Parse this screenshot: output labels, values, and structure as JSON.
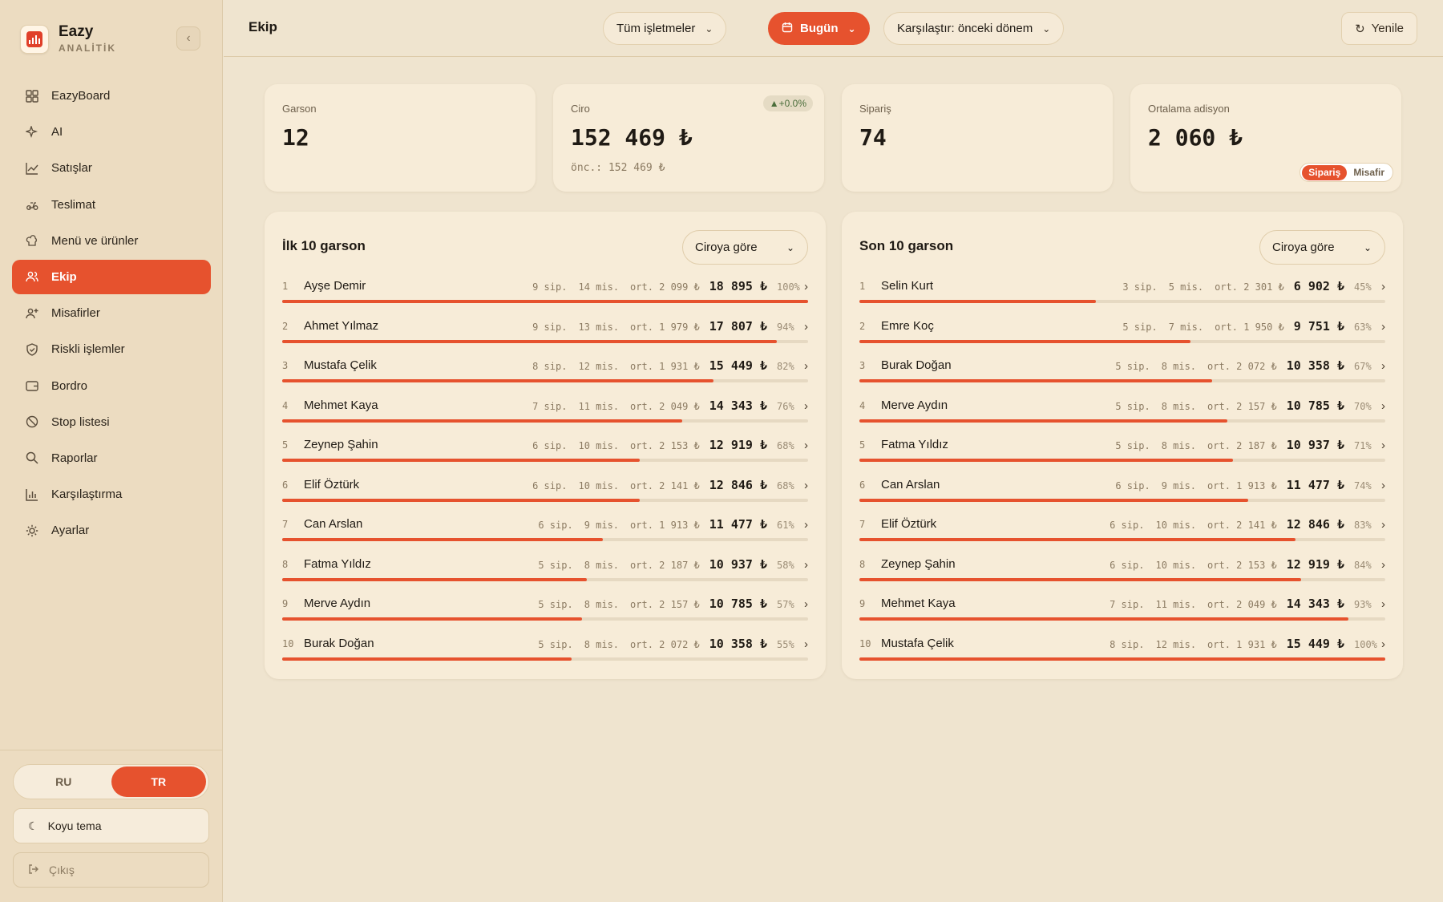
{
  "brand": {
    "name": "Eazy",
    "sub": "ANALİTİK"
  },
  "colors": {
    "accent": "#e6522e",
    "background": "#efe4cf",
    "card": "#f7ecd8"
  },
  "nav": [
    {
      "label": "EazyBoard",
      "icon": "grid-icon"
    },
    {
      "label": "AI",
      "icon": "sparkle-icon"
    },
    {
      "label": "Satışlar",
      "icon": "trend-chart-icon"
    },
    {
      "label": "Teslimat",
      "icon": "scooter-icon"
    },
    {
      "label": "Menü ve ürünler",
      "icon": "chef-icon"
    },
    {
      "label": "Ekip",
      "icon": "team-icon",
      "active": true
    },
    {
      "label": "Misafirler",
      "icon": "user-plus-icon"
    },
    {
      "label": "Riskli işlemler",
      "icon": "shield-icon"
    },
    {
      "label": "Bordro",
      "icon": "wallet-icon"
    },
    {
      "label": "Stop listesi",
      "icon": "ban-icon"
    },
    {
      "label": "Raporlar",
      "icon": "search-icon"
    },
    {
      "label": "Karşılaştırma",
      "icon": "bar-chart-icon"
    },
    {
      "label": "Ayarlar",
      "icon": "sun-gear-icon"
    }
  ],
  "lang": {
    "ru": "RU",
    "tr": "TR",
    "selected": "TR"
  },
  "theme_label": "Koyu tema",
  "logout_label": "Çıkış",
  "header": {
    "title": "Ekip",
    "business_filter": "Tüm işletmeler",
    "date_filter": "Bugün",
    "compare_filter": "Karşılaştır: önceki dönem",
    "refresh": "Yenile"
  },
  "kpis": {
    "waiters": {
      "label": "Garson",
      "value": "12"
    },
    "revenue": {
      "label": "Ciro",
      "value": "152 469 ₺",
      "prev": "önc.: 152 469 ₺",
      "badge": "▲+0.0%"
    },
    "orders": {
      "label": "Sipariş",
      "value": "74"
    },
    "avg_check": {
      "label": "Ortalama adisyon",
      "value": "2 060 ₺",
      "seg_order": "Sipariş",
      "seg_guest": "Misafir",
      "seg_selected": "Sipariş"
    }
  },
  "top_list": {
    "title": "İlk 10 garson",
    "sort": "Ciroya göre",
    "rows": [
      {
        "rank": "1",
        "name": "Ayşe Demir",
        "orders": "9 sip.",
        "guests": "14 mis.",
        "avg": "ort. 2 099 ₺",
        "amount": "18 895 ₺",
        "pct": "100%",
        "fraction": 1.0
      },
      {
        "rank": "2",
        "name": "Ahmet Yılmaz",
        "orders": "9 sip.",
        "guests": "13 mis.",
        "avg": "ort. 1 979 ₺",
        "amount": "17 807 ₺",
        "pct": "94%",
        "fraction": 0.94
      },
      {
        "rank": "3",
        "name": "Mustafa Çelik",
        "orders": "8 sip.",
        "guests": "12 mis.",
        "avg": "ort. 1 931 ₺",
        "amount": "15 449 ₺",
        "pct": "82%",
        "fraction": 0.82
      },
      {
        "rank": "4",
        "name": "Mehmet Kaya",
        "orders": "7 sip.",
        "guests": "11 mis.",
        "avg": "ort. 2 049 ₺",
        "amount": "14 343 ₺",
        "pct": "76%",
        "fraction": 0.76
      },
      {
        "rank": "5",
        "name": "Zeynep Şahin",
        "orders": "6 sip.",
        "guests": "10 mis.",
        "avg": "ort. 2 153 ₺",
        "amount": "12 919 ₺",
        "pct": "68%",
        "fraction": 0.68
      },
      {
        "rank": "6",
        "name": "Elif Öztürk",
        "orders": "6 sip.",
        "guests": "10 mis.",
        "avg": "ort. 2 141 ₺",
        "amount": "12 846 ₺",
        "pct": "68%",
        "fraction": 0.68
      },
      {
        "rank": "7",
        "name": "Can Arslan",
        "orders": "6 sip.",
        "guests": "9 mis.",
        "avg": "ort. 1 913 ₺",
        "amount": "11 477 ₺",
        "pct": "61%",
        "fraction": 0.61
      },
      {
        "rank": "8",
        "name": "Fatma Yıldız",
        "orders": "5 sip.",
        "guests": "8 mis.",
        "avg": "ort. 2 187 ₺",
        "amount": "10 937 ₺",
        "pct": "58%",
        "fraction": 0.58
      },
      {
        "rank": "9",
        "name": "Merve Aydın",
        "orders": "5 sip.",
        "guests": "8 mis.",
        "avg": "ort. 2 157 ₺",
        "amount": "10 785 ₺",
        "pct": "57%",
        "fraction": 0.57
      },
      {
        "rank": "10",
        "name": "Burak Doğan",
        "orders": "5 sip.",
        "guests": "8 mis.",
        "avg": "ort. 2 072 ₺",
        "amount": "10 358 ₺",
        "pct": "55%",
        "fraction": 0.55
      }
    ]
  },
  "bottom_list": {
    "title": "Son 10 garson",
    "sort": "Ciroya göre",
    "rows": [
      {
        "rank": "1",
        "name": "Selin Kurt",
        "orders": "3 sip.",
        "guests": "5 mis.",
        "avg": "ort. 2 301 ₺",
        "amount": "6 902 ₺",
        "pct": "45%",
        "fraction": 0.45
      },
      {
        "rank": "2",
        "name": "Emre Koç",
        "orders": "5 sip.",
        "guests": "7 mis.",
        "avg": "ort. 1 950 ₺",
        "amount": "9 751 ₺",
        "pct": "63%",
        "fraction": 0.63
      },
      {
        "rank": "3",
        "name": "Burak Doğan",
        "orders": "5 sip.",
        "guests": "8 mis.",
        "avg": "ort. 2 072 ₺",
        "amount": "10 358 ₺",
        "pct": "67%",
        "fraction": 0.67
      },
      {
        "rank": "4",
        "name": "Merve Aydın",
        "orders": "5 sip.",
        "guests": "8 mis.",
        "avg": "ort. 2 157 ₺",
        "amount": "10 785 ₺",
        "pct": "70%",
        "fraction": 0.7
      },
      {
        "rank": "5",
        "name": "Fatma Yıldız",
        "orders": "5 sip.",
        "guests": "8 mis.",
        "avg": "ort. 2 187 ₺",
        "amount": "10 937 ₺",
        "pct": "71%",
        "fraction": 0.71
      },
      {
        "rank": "6",
        "name": "Can Arslan",
        "orders": "6 sip.",
        "guests": "9 mis.",
        "avg": "ort. 1 913 ₺",
        "amount": "11 477 ₺",
        "pct": "74%",
        "fraction": 0.74
      },
      {
        "rank": "7",
        "name": "Elif Öztürk",
        "orders": "6 sip.",
        "guests": "10 mis.",
        "avg": "ort. 2 141 ₺",
        "amount": "12 846 ₺",
        "pct": "83%",
        "fraction": 0.83
      },
      {
        "rank": "8",
        "name": "Zeynep Şahin",
        "orders": "6 sip.",
        "guests": "10 mis.",
        "avg": "ort. 2 153 ₺",
        "amount": "12 919 ₺",
        "pct": "84%",
        "fraction": 0.84
      },
      {
        "rank": "9",
        "name": "Mehmet Kaya",
        "orders": "7 sip.",
        "guests": "11 mis.",
        "avg": "ort. 2 049 ₺",
        "amount": "14 343 ₺",
        "pct": "93%",
        "fraction": 0.93
      },
      {
        "rank": "10",
        "name": "Mustafa Çelik",
        "orders": "8 sip.",
        "guests": "12 mis.",
        "avg": "ort. 1 931 ₺",
        "amount": "15 449 ₺",
        "pct": "100%",
        "fraction": 1.0
      }
    ]
  }
}
